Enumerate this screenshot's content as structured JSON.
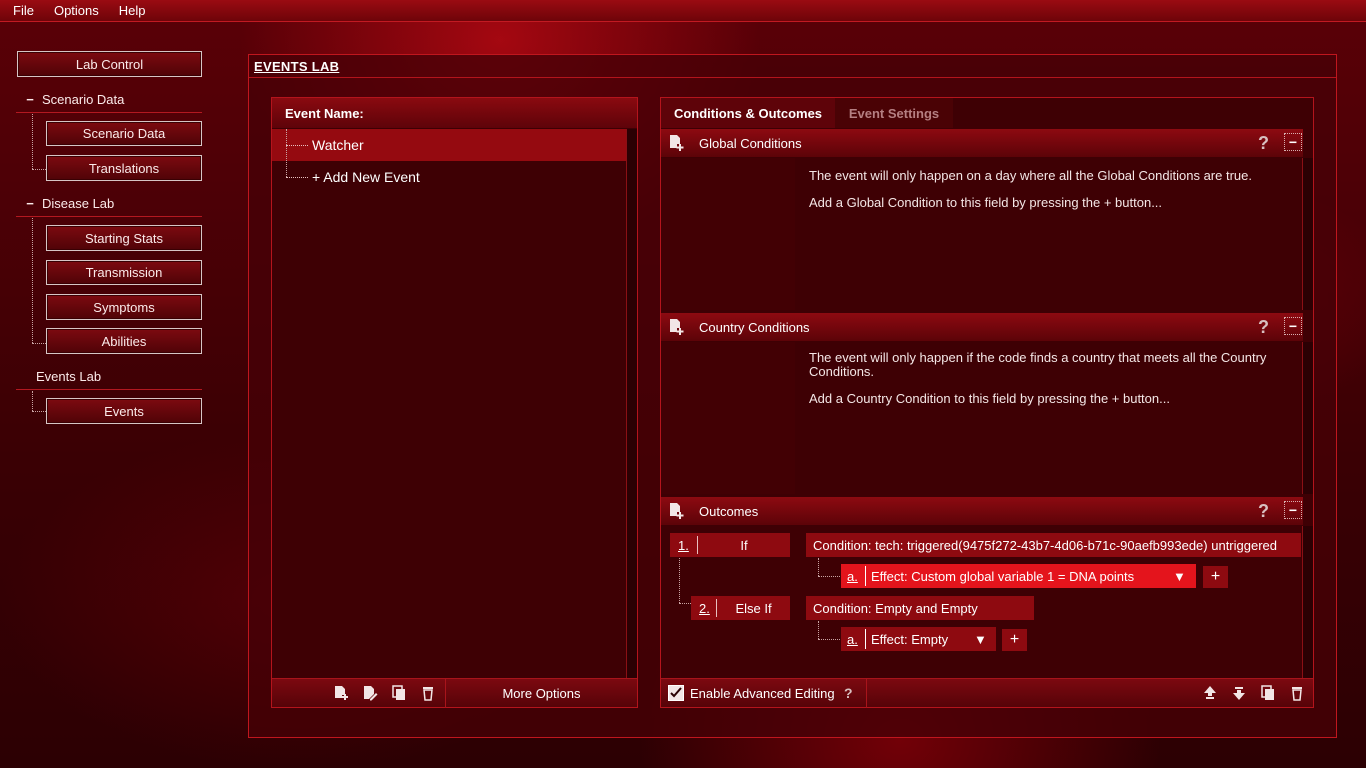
{
  "menu": [
    "File",
    "Options",
    "Help"
  ],
  "nav": {
    "lab_control": "Lab Control",
    "scenario_data_head": "Scenario Data",
    "scenario_data": "Scenario Data",
    "translations": "Translations",
    "disease_lab_head": "Disease Lab",
    "starting_stats": "Starting Stats",
    "transmission": "Transmission",
    "symptoms": "Symptoms",
    "abilities": "Abilities",
    "events_lab_head": "Events Lab",
    "events": "Events"
  },
  "main": {
    "title": "EVENTS LAB"
  },
  "events_list": {
    "header": "Event Name:",
    "items": [
      "Watcher",
      "+ Add New Event"
    ],
    "more_options": "More Options"
  },
  "tabs": {
    "active": "Conditions & Outcomes",
    "inactive": "Event Settings"
  },
  "global": {
    "title": "Global Conditions",
    "line1": "The event will only happen on a day where all the Global Conditions are true.",
    "line2": "Add a Global Condition to this field by pressing the + button..."
  },
  "country": {
    "title": "Country Conditions",
    "line1": "The event will only happen if the code finds a country that meets all the Country Conditions.",
    "line2": "Add a Country Condition to this field by pressing the + button..."
  },
  "outcomes": {
    "title": "Outcomes",
    "rows": [
      {
        "num": "1.",
        "kind": "If",
        "condition": "Condition:  tech: triggered(9475f272-43b7-4d06-b71c-90aefb993ede) untriggered",
        "effect_letter": "a.",
        "effect": "Effect:  Custom global variable 1 = DNA points"
      },
      {
        "num": "2.",
        "kind": "Else If",
        "condition": "Condition:  Empty and Empty",
        "effect_letter": "a.",
        "effect": "Effect:  Empty"
      }
    ],
    "add": "+",
    "help": "?",
    "collapse": "−"
  },
  "footer": {
    "enable_advanced": "Enable Advanced Editing",
    "help": "?"
  },
  "symbols": {
    "help": "?",
    "collapse": "−",
    "dropdown": "▼",
    "check": "✓"
  }
}
